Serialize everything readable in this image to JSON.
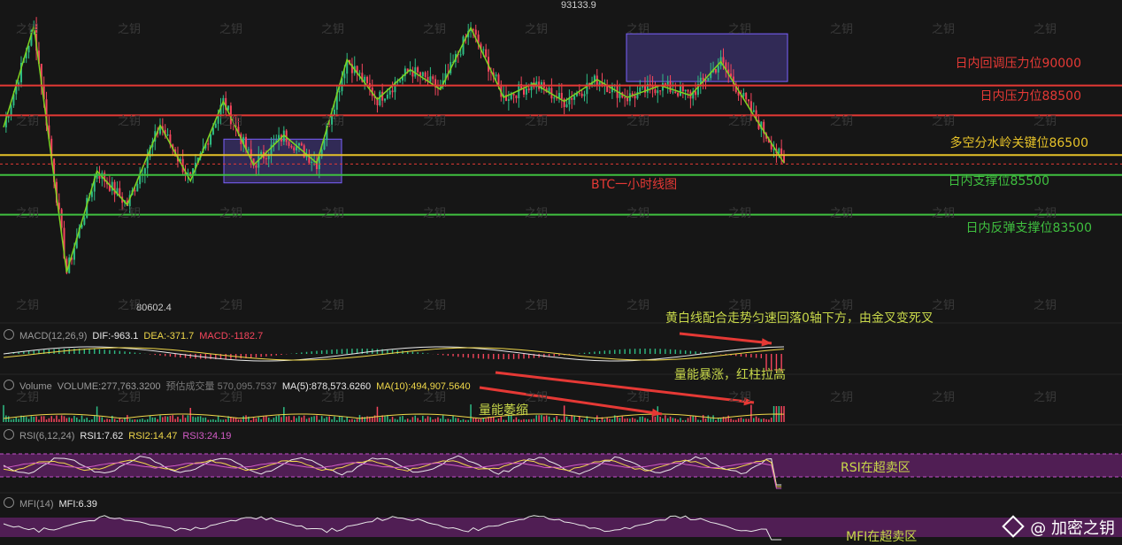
{
  "chart_data": {
    "type": "candlestick",
    "title": "BTC一小时线图",
    "price_range": [
      78500,
      94300
    ],
    "high_label": "93133.9",
    "low_label": "80602.4",
    "levels": [
      {
        "price": 90000,
        "label": "日内回调压力位90000",
        "color": "#e53935"
      },
      {
        "price": 88500,
        "label": "日内压力位88500",
        "color": "#e53935"
      },
      {
        "price": 86500,
        "label": "多空分水岭关键位86500",
        "color": "#e6c229"
      },
      {
        "price": 85500,
        "label": "日内支撑位85500",
        "color": "#3fbf3f"
      },
      {
        "price": 83500,
        "label": "日内反弹支撑位83500",
        "color": "#3fbf3f"
      }
    ],
    "current_price_line": 86050,
    "zigzag_prices": [
      87900,
      93000,
      80600,
      85700,
      84000,
      88000,
      85200,
      89200,
      86000,
      87500,
      86100,
      91300,
      89300,
      90800,
      89800,
      92900,
      89400,
      90100,
      89200,
      90300,
      89400,
      90000,
      89500,
      91200,
      88500,
      86100
    ],
    "consolidation_boxes": [
      {
        "price_top": 87300,
        "price_bottom": 85100
      },
      {
        "price_top": 92600,
        "price_bottom": 90200
      }
    ],
    "indicators": {
      "macd": {
        "params": "MACD(12,26,9)",
        "dif": "DIF:-963.1",
        "dea": "DEA:-371.7",
        "macd": "MACD:-1182.7"
      },
      "volume": {
        "label": "Volume",
        "volume": "VOLUME:277,763.3200",
        "est": "预估成交量 570,095.7537",
        "ma5": "MA(5):878,573.6260",
        "ma10": "MA(10):494,907.5640"
      },
      "rsi": {
        "params": "RSI(6,12,24)",
        "rsi1": "RSI1:7.62",
        "rsi2": "RSI2:14.47",
        "rsi3": "RSI3:24.19"
      },
      "mfi": {
        "params": "MFI(14)",
        "mfi": "MFI:6.39"
      }
    },
    "colors": {
      "up": "#2ebd85",
      "down": "#f6465d",
      "zigzag": "#7ed321",
      "box": "#7b61ff"
    }
  },
  "annotations": {
    "macd_note": "黄白线配合走势匀速回落0轴下方，由金叉变死叉",
    "volume_note_high": "量能暴涨，红柱拉高",
    "volume_note_low": "量能萎缩",
    "rsi_note": "RSI在超卖区",
    "mfi_note": "MFI在超卖区"
  },
  "watermark": "之钥",
  "brand": "@ 加密之钥"
}
